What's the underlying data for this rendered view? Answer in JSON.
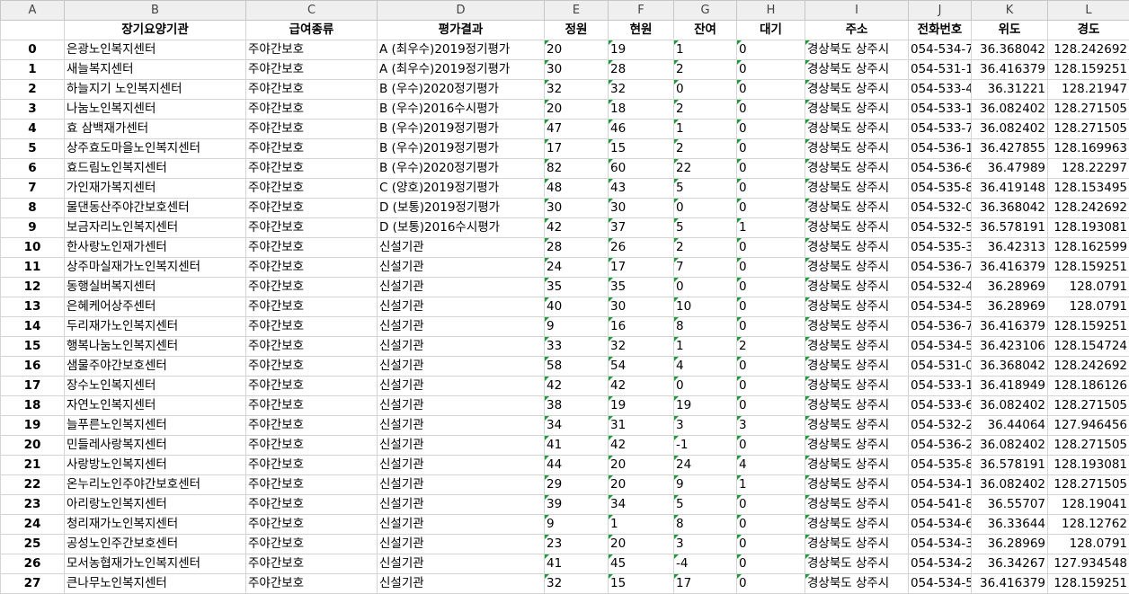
{
  "columns": [
    "A",
    "B",
    "C",
    "D",
    "E",
    "F",
    "G",
    "H",
    "I",
    "J",
    "K",
    "L"
  ],
  "headers": [
    "",
    "장기요양기관",
    "급여종류",
    "평가결과",
    "정원",
    "현원",
    "잔여",
    "대기",
    "주소",
    "전화번호",
    "위도",
    "경도"
  ],
  "rows": [
    [
      "0",
      "은광노인복지센터",
      "주야간보호",
      "A (최우수)2019정기평가",
      "20",
      "19",
      "1",
      "0",
      "경상북도 상주시",
      "054-534-7",
      "36.368042",
      "128.242692"
    ],
    [
      "1",
      "새늘복지센터",
      "주야간보호",
      "A (최우수)2019정기평가",
      "30",
      "28",
      "2",
      "0",
      "경상북도 상주시",
      "054-531-1",
      "36.416379",
      "128.159251"
    ],
    [
      "2",
      "하늘지기 노인복지센터",
      "주야간보호",
      "B (우수)2020정기평가",
      "32",
      "32",
      "0",
      "0",
      "경상북도 상주시",
      "054-533-4",
      "36.31221",
      "128.21947"
    ],
    [
      "3",
      "나눔노인복지센터",
      "주야간보호",
      "B (우수)2016수시평가",
      "20",
      "18",
      "2",
      "0",
      "경상북도 상주시",
      "054-533-1",
      "36.082402",
      "128.271505"
    ],
    [
      "4",
      "효 삼백재가센터",
      "주야간보호",
      "B (우수)2019정기평가",
      "47",
      "46",
      "1",
      "0",
      "경상북도 상주시",
      "054-533-7",
      "36.082402",
      "128.271505"
    ],
    [
      "5",
      "상주효도마을노인복지센터",
      "주야간보호",
      "B (우수)2019정기평가",
      "17",
      "15",
      "2",
      "0",
      "경상북도 상주시",
      "054-536-1",
      "36.427855",
      "128.169963"
    ],
    [
      "6",
      "효드림노인복지센터",
      "주야간보호",
      "B (우수)2020정기평가",
      "82",
      "60",
      "22",
      "0",
      "경상북도 상주시",
      "054-536-6",
      "36.47989",
      "128.22297"
    ],
    [
      "7",
      "가인재가복지센터",
      "주야간보호",
      "C (양호)2019정기평가",
      "48",
      "43",
      "5",
      "0",
      "경상북도 상주시",
      "054-535-8",
      "36.419148",
      "128.153495"
    ],
    [
      "8",
      "물댄동산주야간보호센터",
      "주야간보호",
      "D (보통)2019정기평가",
      "30",
      "30",
      "0",
      "0",
      "경상북도 상주시",
      "054-532-0",
      "36.368042",
      "128.242692"
    ],
    [
      "9",
      "보금자리노인복지센터",
      "주야간보호",
      "D (보통)2016수시평가",
      "42",
      "37",
      "5",
      "1",
      "경상북도 상주시",
      "054-532-5",
      "36.578191",
      "128.193081"
    ],
    [
      "10",
      "한사랑노인재가센터",
      "주야간보호",
      "신설기관",
      "28",
      "26",
      "2",
      "0",
      "경상북도 상주시",
      "054-535-3",
      "36.42313",
      "128.162599"
    ],
    [
      "11",
      "상주마실재가노인복지센터",
      "주야간보호",
      "신설기관",
      "24",
      "17",
      "7",
      "0",
      "경상북도 상주시",
      "054-536-7",
      "36.416379",
      "128.159251"
    ],
    [
      "12",
      "동행실버복지센터",
      "주야간보호",
      "신설기관",
      "35",
      "35",
      "0",
      "0",
      "경상북도 상주시",
      "054-532-4",
      "36.28969",
      "128.0791"
    ],
    [
      "13",
      "은혜케어상주센터",
      "주야간보호",
      "신설기관",
      "40",
      "30",
      "10",
      "0",
      "경상북도 상주시",
      "054-534-5",
      "36.28969",
      "128.0791"
    ],
    [
      "14",
      "두리재가노인복지센터",
      "주야간보호",
      "신설기관",
      "9",
      "16",
      "8",
      "0",
      "경상북도 상주시",
      "054-536-7",
      "36.416379",
      "128.159251"
    ],
    [
      "15",
      "행복나눔노인복지센터",
      "주야간보호",
      "신설기관",
      "33",
      "32",
      "1",
      "2",
      "경상북도 상주시",
      "054-534-5",
      "36.423106",
      "128.154724"
    ],
    [
      "16",
      "샘물주야간보호센터",
      "주야간보호",
      "신설기관",
      "58",
      "54",
      "4",
      "0",
      "경상북도 상주시",
      "054-531-0",
      "36.368042",
      "128.242692"
    ],
    [
      "17",
      "장수노인복지센터",
      "주야간보호",
      "신설기관",
      "42",
      "42",
      "0",
      "0",
      "경상북도 상주시",
      "054-533-1",
      "36.418949",
      "128.186126"
    ],
    [
      "18",
      "자연노인복지센터",
      "주야간보호",
      "신설기관",
      "38",
      "19",
      "19",
      "0",
      "경상북도 상주시",
      "054-533-6",
      "36.082402",
      "128.271505"
    ],
    [
      "19",
      "늘푸른노인복지센터",
      "주야간보호",
      "신설기관",
      "34",
      "31",
      "3",
      "3",
      "경상북도 상주시",
      "054-532-2",
      "36.44064",
      "127.946456"
    ],
    [
      "20",
      "민들레사랑복지센터",
      "주야간보호",
      "신설기관",
      "41",
      "42",
      "-1",
      "0",
      "경상북도 상주시",
      "054-536-2",
      "36.082402",
      "128.271505"
    ],
    [
      "21",
      "사랑방노인복지센터",
      "주야간보호",
      "신설기관",
      "44",
      "20",
      "24",
      "4",
      "경상북도 상주시",
      "054-535-8",
      "36.578191",
      "128.193081"
    ],
    [
      "22",
      "온누리노인주야간보호센터",
      "주야간보호",
      "신설기관",
      "29",
      "20",
      "9",
      "1",
      "경상북도 상주시",
      "054-534-1",
      "36.082402",
      "128.271505"
    ],
    [
      "23",
      "아리랑노인복지센터",
      "주야간보호",
      "신설기관",
      "39",
      "34",
      "5",
      "0",
      "경상북도 상주시",
      "054-541-8",
      "36.55707",
      "128.19041"
    ],
    [
      "24",
      "청리재가노인복지센터",
      "주야간보호",
      "신설기관",
      "9",
      "1",
      "8",
      "0",
      "경상북도 상주시",
      "054-534-6",
      "36.33644",
      "128.12762"
    ],
    [
      "25",
      "공성노인주간보호센터",
      "주야간보호",
      "신설기관",
      "23",
      "20",
      "3",
      "0",
      "경상북도 상주시",
      "054-534-3",
      "36.28969",
      "128.0791"
    ],
    [
      "26",
      "모서농협재가노인복지센터",
      "주야간보호",
      "신설기관",
      "41",
      "45",
      "-4",
      "0",
      "경상북도 상주시",
      "054-534-2",
      "36.34267",
      "127.934548"
    ],
    [
      "27",
      "큰나무노인복지센터",
      "주야간보호",
      "신설기관",
      "32",
      "15",
      "17",
      "0",
      "경상북도 상주시",
      "054-534-5",
      "36.416379",
      "128.159251"
    ]
  ]
}
